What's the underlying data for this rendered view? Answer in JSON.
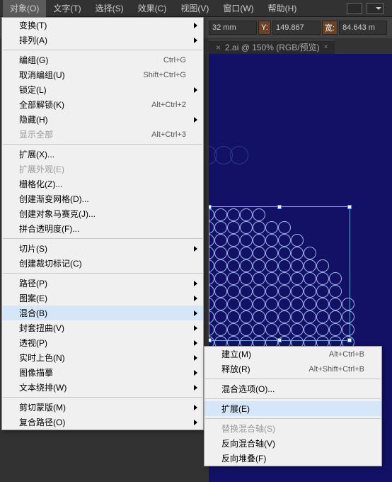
{
  "menubar": {
    "items": [
      "对象(O)",
      "文字(T)",
      "选择(S)",
      "效果(C)",
      "视图(V)",
      "窗口(W)",
      "帮助(H)"
    ]
  },
  "toolbar": {
    "val1": "32 mm",
    "lblY": "Y:",
    "val2": "149.867",
    "lblW": "宽:",
    "val3": "84.643 m"
  },
  "tab": {
    "label": "2.ai @ 150% (RGB/预览)",
    "close": "×"
  },
  "menu": [
    {
      "t": "sub",
      "label": "变换(T)"
    },
    {
      "t": "sub",
      "label": "排列(A)"
    },
    {
      "t": "sep"
    },
    {
      "t": "item",
      "label": "编组(G)",
      "sc": "Ctrl+G"
    },
    {
      "t": "item",
      "label": "取消编组(U)",
      "sc": "Shift+Ctrl+G"
    },
    {
      "t": "sub",
      "label": "锁定(L)"
    },
    {
      "t": "item",
      "label": "全部解锁(K)",
      "sc": "Alt+Ctrl+2"
    },
    {
      "t": "sub",
      "label": "隐藏(H)"
    },
    {
      "t": "item",
      "label": "显示全部",
      "sc": "Alt+Ctrl+3",
      "dis": true
    },
    {
      "t": "sep"
    },
    {
      "t": "item",
      "label": "扩展(X)..."
    },
    {
      "t": "item",
      "label": "扩展外观(E)",
      "dis": true
    },
    {
      "t": "item",
      "label": "栅格化(Z)..."
    },
    {
      "t": "item",
      "label": "创建渐变网格(D)..."
    },
    {
      "t": "item",
      "label": "创建对象马赛克(J)..."
    },
    {
      "t": "item",
      "label": "拼合透明度(F)..."
    },
    {
      "t": "sep"
    },
    {
      "t": "sub",
      "label": "切片(S)"
    },
    {
      "t": "item",
      "label": "创建裁切标记(C)"
    },
    {
      "t": "sep"
    },
    {
      "t": "sub",
      "label": "路径(P)"
    },
    {
      "t": "sub",
      "label": "图案(E)"
    },
    {
      "t": "sub",
      "label": "混合(B)",
      "hl": true
    },
    {
      "t": "sub",
      "label": "封套扭曲(V)"
    },
    {
      "t": "sub",
      "label": "透视(P)"
    },
    {
      "t": "sub",
      "label": "实时上色(N)"
    },
    {
      "t": "sub",
      "label": "图像描摹"
    },
    {
      "t": "sub",
      "label": "文本绕排(W)"
    },
    {
      "t": "sep"
    },
    {
      "t": "sub",
      "label": "剪切蒙版(M)"
    },
    {
      "t": "sub",
      "label": "复合路径(O)"
    }
  ],
  "submenu": [
    {
      "t": "item",
      "label": "建立(M)",
      "sc": "Alt+Ctrl+B"
    },
    {
      "t": "item",
      "label": "释放(R)",
      "sc": "Alt+Shift+Ctrl+B"
    },
    {
      "t": "sep"
    },
    {
      "t": "item",
      "label": "混合选项(O)..."
    },
    {
      "t": "sep"
    },
    {
      "t": "item",
      "label": "扩展(E)",
      "hl": true
    },
    {
      "t": "sep"
    },
    {
      "t": "item",
      "label": "替换混合轴(S)",
      "dis": true
    },
    {
      "t": "item",
      "label": "反向混合轴(V)"
    },
    {
      "t": "item",
      "label": "反向堆叠(F)"
    }
  ]
}
